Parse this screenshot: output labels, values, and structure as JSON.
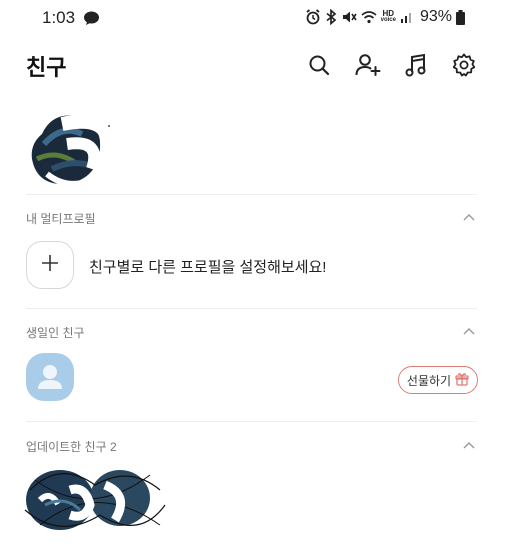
{
  "status_bar": {
    "time": "1:03",
    "battery_percent": "93%",
    "hd_label": "HD",
    "voice_label": "voice",
    "icons": [
      "chat-bubble-icon",
      "alarm-icon",
      "bluetooth-icon",
      "mute-icon",
      "wifi-icon",
      "signal-icon",
      "battery-icon"
    ]
  },
  "header": {
    "title": "친구",
    "icons": [
      "search-icon",
      "add-friend-icon",
      "music-icon",
      "settings-icon"
    ]
  },
  "sections": {
    "multi_profile": {
      "title": "내 멀티프로필",
      "add_text": "친구별로 다른 프로필을 설정해보세요!"
    },
    "birthday": {
      "title": "생일인 친구",
      "gift_label": "선물하기"
    },
    "updated": {
      "title": "업데이트한 친구 2"
    }
  },
  "colors": {
    "accent_gift": "#e07b74",
    "avatar_blue": "#a9cde8"
  }
}
